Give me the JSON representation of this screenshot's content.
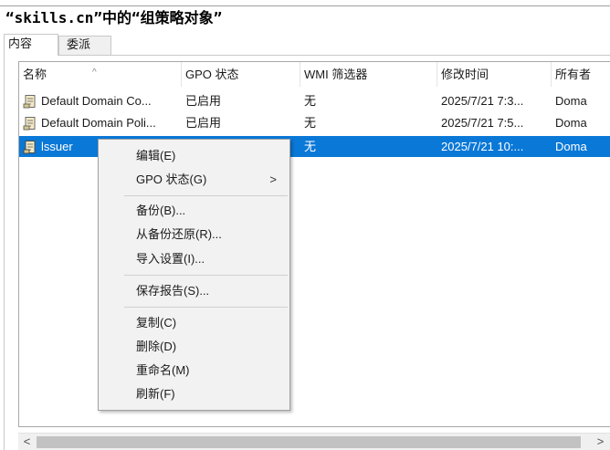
{
  "window": {
    "title": "“skills.cn”中的“组策略对象”"
  },
  "tabs": [
    {
      "label": "内容",
      "active": true
    },
    {
      "label": "委派",
      "active": false
    }
  ],
  "table": {
    "columns": [
      "名称",
      "GPO 状态",
      "WMI 筛选器",
      "修改时间",
      "所有者"
    ],
    "rows": [
      {
        "name": "Default Domain Co...",
        "status": "已启用",
        "wmi": "无",
        "modified": "2025/7/21 7:3...",
        "owner": "Doma",
        "selected": false
      },
      {
        "name": "Default Domain Poli...",
        "status": "已启用",
        "wmi": "无",
        "modified": "2025/7/21 7:5...",
        "owner": "Doma",
        "selected": false
      },
      {
        "name": "lssuer",
        "status": "",
        "wmi": "无",
        "modified": "2025/7/21 10:...",
        "owner": "Doma",
        "selected": true
      }
    ]
  },
  "context_menu": {
    "items": [
      {
        "label": "编辑(E)"
      },
      {
        "label": "GPO 状态(G)",
        "submenu_arrow": ">"
      },
      {
        "label": "备份(B)..."
      },
      {
        "label": "从备份还原(R)..."
      },
      {
        "label": "导入设置(I)..."
      },
      {
        "label": "保存报告(S)..."
      },
      {
        "label": "复制(C)"
      },
      {
        "label": "删除(D)"
      },
      {
        "label": "重命名(M)"
      },
      {
        "label": "刷新(F)"
      }
    ]
  },
  "scrollbar": {
    "left_arrow": "<",
    "right_arrow": ">"
  },
  "colors": {
    "selection": "#0a78d7",
    "menu_bg": "#f2f2f2",
    "scroll_thumb": "#c2c2c2"
  },
  "icons": {
    "row_icon": "gpo-scroll-icon",
    "sort": "sort-ascending-icon"
  }
}
